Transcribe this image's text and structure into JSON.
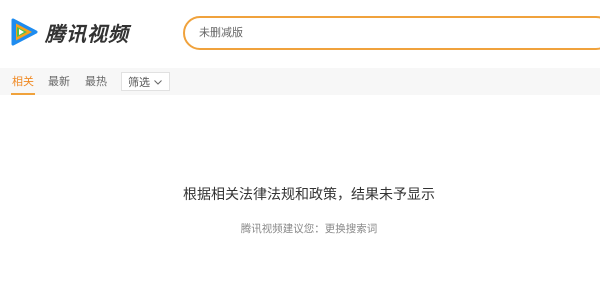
{
  "header": {
    "logo_text": "腾讯视频",
    "logo_icon": "tencent-video-play-icon",
    "brand_colors": [
      "#1e8cf0",
      "#f7a21b",
      "#4cc04c"
    ]
  },
  "search": {
    "value": "未删减版",
    "border_color": "#f0a23c"
  },
  "tabs": [
    {
      "label": "相关",
      "active": true
    },
    {
      "label": "最新",
      "active": false
    },
    {
      "label": "最热",
      "active": false
    }
  ],
  "filter": {
    "label": "筛选",
    "icon": "chevron-down-icon"
  },
  "empty_state": {
    "message": "根据相关法律法规和政策，结果未予显示",
    "suggestion": "腾讯视频建议您：更换搜索词"
  },
  "colors": {
    "accent": "#f08a24",
    "tabbar_bg": "#f7f7f7",
    "text_primary": "#333333",
    "text_secondary": "#888888"
  }
}
